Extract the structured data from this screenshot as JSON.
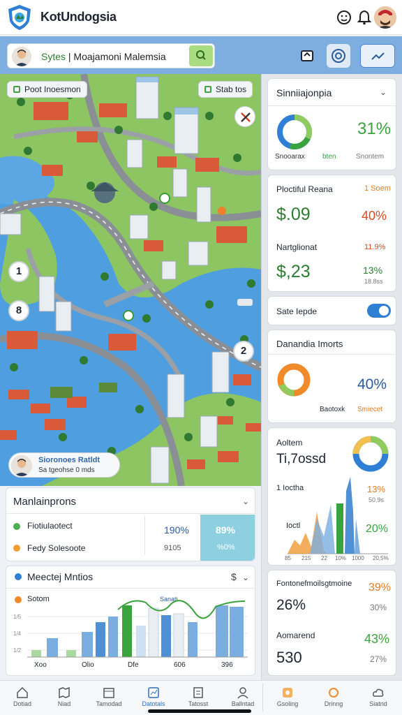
{
  "header": {
    "app_title": "KotUndogsia",
    "icons": [
      "shield-logo-icon",
      "emoji-icon",
      "bell-icon",
      "avatar"
    ]
  },
  "toolbar": {
    "search": {
      "highlight": "Sytes",
      "value": " | Moajamoni Malemsia"
    },
    "buttons": [
      "layers-icon",
      "target-icon",
      "chart-icon"
    ]
  },
  "map": {
    "chip_left": "Poot Inoesmon",
    "chip_right": "Stab tos",
    "markers": [
      "1",
      "8",
      "2"
    ],
    "user_chip": {
      "name": "Sioronoes Ratldt",
      "subtitle": "Sa tgeohse 0 mds"
    }
  },
  "maintenance": {
    "title": "Manlainprons",
    "rows": [
      {
        "label": "Fiotiulaotect",
        "value": "190%",
        "status_color": "#4caf50"
      },
      {
        "label": "Fedy Solesoote",
        "value": "9105",
        "status_color": "#f0a030"
      }
    ],
    "highlight_top": "89%",
    "highlight_bottom": "%0%"
  },
  "metrics_panel": {
    "title": "Meectej Mntios",
    "currency_icon": "dollar-icon",
    "legend": "Sotom",
    "chart_caption": "Sanati",
    "x_labels": [
      "Xoo",
      "Olio",
      "Dfe",
      "606",
      "396"
    ]
  },
  "right": {
    "card1": {
      "title": "Sinniiajonpia",
      "value": "31%",
      "label_a": "Snooarax",
      "label_b": "bten",
      "label_c": "Snontem"
    },
    "card2": {
      "title": "Ploctiful Reana",
      "tag": "1 Soem",
      "value1": "$.09",
      "pct1": "40%",
      "subtitle": "Nartglionat",
      "tag2": "11.9%",
      "value2": "$,23",
      "pct2": "13%",
      "small": "18.8ss"
    },
    "toggle": {
      "label": "Sate Iepde",
      "on": true
    },
    "card3": {
      "title": "Danandia Imorts",
      "value": "40%",
      "label_a": "Baotoxk",
      "label_b": "Smiecet"
    },
    "card4": {
      "title": "Aoltem",
      "value": "Ti,7ossd",
      "subtitle": "1 Ioctha",
      "tag1": "13%",
      "tag1_sub": "50.9s",
      "label_left": "Ioctl",
      "tag2": "20%",
      "x_labels": [
        "85",
        "215",
        "22",
        "10%",
        "1000",
        "20,5%"
      ]
    },
    "card5": {
      "title1": "Fontonefmoilsgtmoine",
      "value1": "26%",
      "pct1": "39%",
      "sub1": "30%",
      "title2": "Aomarend",
      "value2": "530",
      "pct2": "43%",
      "sub2": "27%"
    }
  },
  "bottom_nav": [
    {
      "label": "Dotiad",
      "icon": "home-icon"
    },
    {
      "label": "Niad",
      "icon": "map-icon"
    },
    {
      "label": "Tamodad",
      "icon": "calendar-icon"
    },
    {
      "label": "Datotals",
      "icon": "dashboard-icon"
    },
    {
      "label": "Tatosst",
      "icon": "reports-icon"
    },
    {
      "label": "Ballntad",
      "icon": "user-icon"
    },
    {
      "label": "Gsoling",
      "icon": "settings-icon"
    },
    {
      "label": "Drinng",
      "icon": "sync-icon"
    },
    {
      "label": "Siatnd",
      "icon": "cloud-icon"
    }
  ],
  "colors": {
    "accent_blue": "#2f7fd4",
    "green": "#3aa33e",
    "orange": "#e87a1e",
    "teal_highlight": "#8fd0e0",
    "toolbar": "#7eaee0"
  }
}
